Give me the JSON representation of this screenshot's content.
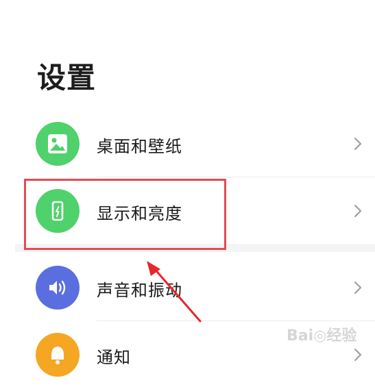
{
  "page": {
    "title": "设置"
  },
  "settings": {
    "items": [
      {
        "label": "桌面和壁纸",
        "icon": "image-icon",
        "icon_color": "#4fd16b"
      },
      {
        "label": "显示和亮度",
        "icon": "phone-brightness-icon",
        "icon_color": "#4fd16b"
      },
      {
        "label": "声音和振动",
        "icon": "speaker-icon",
        "icon_color": "#5b6ee0"
      },
      {
        "label": "通知",
        "icon": "bell-icon",
        "icon_color": "#f5a623"
      }
    ]
  },
  "annotation": {
    "highlight_color": "#e34b53",
    "arrow_color": "#e8262b"
  },
  "watermark": {
    "text": "Bai◎经验"
  }
}
